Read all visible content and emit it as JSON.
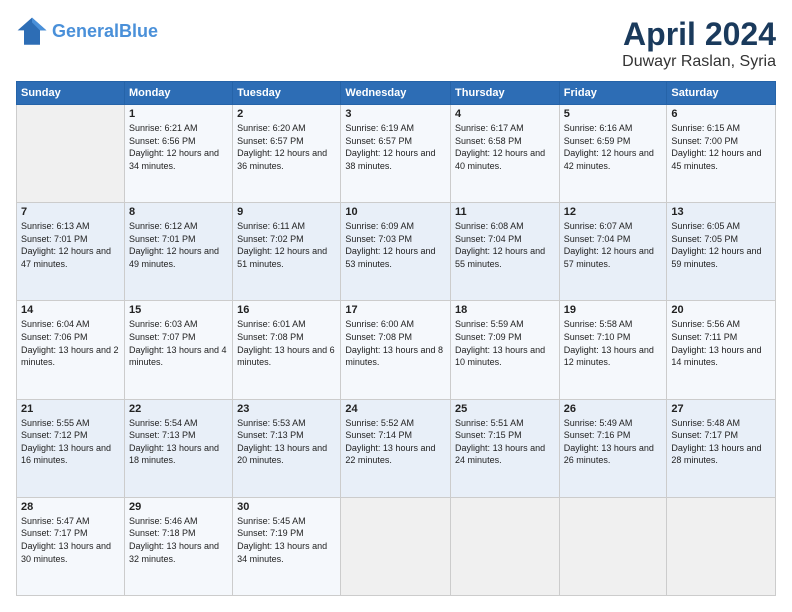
{
  "logo": {
    "line1": "General",
    "line2": "Blue"
  },
  "title": "April 2024",
  "location": "Duwayr Raslan, Syria",
  "header_days": [
    "Sunday",
    "Monday",
    "Tuesday",
    "Wednesday",
    "Thursday",
    "Friday",
    "Saturday"
  ],
  "weeks": [
    [
      {
        "day": "",
        "info": ""
      },
      {
        "day": "1",
        "info": "Sunrise: 6:21 AM\nSunset: 6:56 PM\nDaylight: 12 hours\nand 34 minutes."
      },
      {
        "day": "2",
        "info": "Sunrise: 6:20 AM\nSunset: 6:57 PM\nDaylight: 12 hours\nand 36 minutes."
      },
      {
        "day": "3",
        "info": "Sunrise: 6:19 AM\nSunset: 6:57 PM\nDaylight: 12 hours\nand 38 minutes."
      },
      {
        "day": "4",
        "info": "Sunrise: 6:17 AM\nSunset: 6:58 PM\nDaylight: 12 hours\nand 40 minutes."
      },
      {
        "day": "5",
        "info": "Sunrise: 6:16 AM\nSunset: 6:59 PM\nDaylight: 12 hours\nand 42 minutes."
      },
      {
        "day": "6",
        "info": "Sunrise: 6:15 AM\nSunset: 7:00 PM\nDaylight: 12 hours\nand 45 minutes."
      }
    ],
    [
      {
        "day": "7",
        "info": "Sunrise: 6:13 AM\nSunset: 7:01 PM\nDaylight: 12 hours\nand 47 minutes."
      },
      {
        "day": "8",
        "info": "Sunrise: 6:12 AM\nSunset: 7:01 PM\nDaylight: 12 hours\nand 49 minutes."
      },
      {
        "day": "9",
        "info": "Sunrise: 6:11 AM\nSunset: 7:02 PM\nDaylight: 12 hours\nand 51 minutes."
      },
      {
        "day": "10",
        "info": "Sunrise: 6:09 AM\nSunset: 7:03 PM\nDaylight: 12 hours\nand 53 minutes."
      },
      {
        "day": "11",
        "info": "Sunrise: 6:08 AM\nSunset: 7:04 PM\nDaylight: 12 hours\nand 55 minutes."
      },
      {
        "day": "12",
        "info": "Sunrise: 6:07 AM\nSunset: 7:04 PM\nDaylight: 12 hours\nand 57 minutes."
      },
      {
        "day": "13",
        "info": "Sunrise: 6:05 AM\nSunset: 7:05 PM\nDaylight: 12 hours\nand 59 minutes."
      }
    ],
    [
      {
        "day": "14",
        "info": "Sunrise: 6:04 AM\nSunset: 7:06 PM\nDaylight: 13 hours\nand 2 minutes."
      },
      {
        "day": "15",
        "info": "Sunrise: 6:03 AM\nSunset: 7:07 PM\nDaylight: 13 hours\nand 4 minutes."
      },
      {
        "day": "16",
        "info": "Sunrise: 6:01 AM\nSunset: 7:08 PM\nDaylight: 13 hours\nand 6 minutes."
      },
      {
        "day": "17",
        "info": "Sunrise: 6:00 AM\nSunset: 7:08 PM\nDaylight: 13 hours\nand 8 minutes."
      },
      {
        "day": "18",
        "info": "Sunrise: 5:59 AM\nSunset: 7:09 PM\nDaylight: 13 hours\nand 10 minutes."
      },
      {
        "day": "19",
        "info": "Sunrise: 5:58 AM\nSunset: 7:10 PM\nDaylight: 13 hours\nand 12 minutes."
      },
      {
        "day": "20",
        "info": "Sunrise: 5:56 AM\nSunset: 7:11 PM\nDaylight: 13 hours\nand 14 minutes."
      }
    ],
    [
      {
        "day": "21",
        "info": "Sunrise: 5:55 AM\nSunset: 7:12 PM\nDaylight: 13 hours\nand 16 minutes."
      },
      {
        "day": "22",
        "info": "Sunrise: 5:54 AM\nSunset: 7:13 PM\nDaylight: 13 hours\nand 18 minutes."
      },
      {
        "day": "23",
        "info": "Sunrise: 5:53 AM\nSunset: 7:13 PM\nDaylight: 13 hours\nand 20 minutes."
      },
      {
        "day": "24",
        "info": "Sunrise: 5:52 AM\nSunset: 7:14 PM\nDaylight: 13 hours\nand 22 minutes."
      },
      {
        "day": "25",
        "info": "Sunrise: 5:51 AM\nSunset: 7:15 PM\nDaylight: 13 hours\nand 24 minutes."
      },
      {
        "day": "26",
        "info": "Sunrise: 5:49 AM\nSunset: 7:16 PM\nDaylight: 13 hours\nand 26 minutes."
      },
      {
        "day": "27",
        "info": "Sunrise: 5:48 AM\nSunset: 7:17 PM\nDaylight: 13 hours\nand 28 minutes."
      }
    ],
    [
      {
        "day": "28",
        "info": "Sunrise: 5:47 AM\nSunset: 7:17 PM\nDaylight: 13 hours\nand 30 minutes."
      },
      {
        "day": "29",
        "info": "Sunrise: 5:46 AM\nSunset: 7:18 PM\nDaylight: 13 hours\nand 32 minutes."
      },
      {
        "day": "30",
        "info": "Sunrise: 5:45 AM\nSunset: 7:19 PM\nDaylight: 13 hours\nand 34 minutes."
      },
      {
        "day": "",
        "info": ""
      },
      {
        "day": "",
        "info": ""
      },
      {
        "day": "",
        "info": ""
      },
      {
        "day": "",
        "info": ""
      }
    ]
  ]
}
